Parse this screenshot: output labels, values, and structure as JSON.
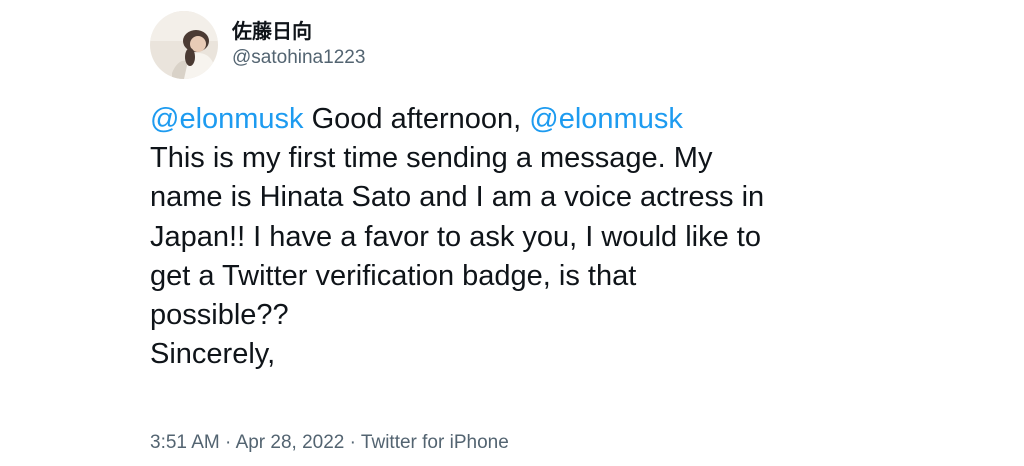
{
  "author": {
    "display_name": "佐藤日向",
    "handle": "@satohina1223"
  },
  "tweet": {
    "mention_1": "@elonmusk",
    "text_1": " Good afternoon, ",
    "mention_2": "@elonmusk",
    "lines": [
      "This is my first time sending a message. My",
      "name is Hinata Sato and I am a voice actress in",
      "Japan!! I have a favor to ask you, I would like to",
      "get a Twitter verification badge, is that",
      "possible??",
      "Sincerely,"
    ]
  },
  "meta": {
    "time": "3:51 AM",
    "separator_1": " · ",
    "date": "Apr 28, 2022",
    "separator_2": " · ",
    "source": "Twitter for iPhone"
  },
  "colors": {
    "mention": "#1d9bf0",
    "text": "#0f1419",
    "secondary": "#536471",
    "background": "#ffffff"
  }
}
